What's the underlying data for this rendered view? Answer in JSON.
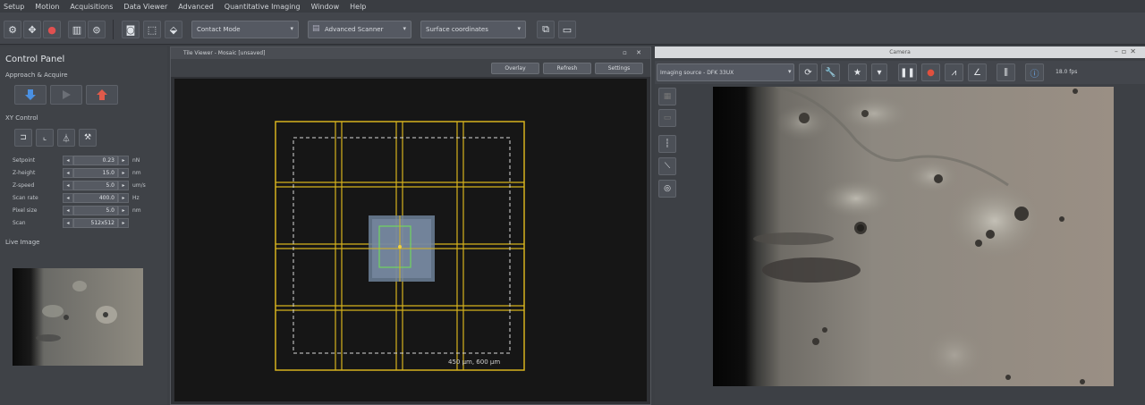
{
  "menu": [
    "Setup",
    "Motion",
    "Acquisitions",
    "Data Viewer",
    "Advanced",
    "Quantitative Imaging",
    "Window",
    "Help"
  ],
  "toolbar": {
    "stage_mode": "Contact Mode",
    "scan_mode": "Advanced Scanner",
    "coord_mode": "Surface coordinates"
  },
  "control_panel": {
    "title": "Control Panel",
    "approach_label": "Approach & Acquire",
    "xy_label": "XY Control",
    "live_label": "Live Image",
    "params": [
      {
        "label": "Setpoint",
        "value": "0.23",
        "unit": "nN"
      },
      {
        "label": "Z-height",
        "value": "15.0",
        "unit": "nm"
      },
      {
        "label": "Z-speed",
        "value": "5.0",
        "unit": "um/s"
      },
      {
        "label": "Scan rate",
        "value": "400.0",
        "unit": "Hz"
      },
      {
        "label": "Pixel size",
        "value": "5.0",
        "unit": "nm"
      },
      {
        "label": "Scan",
        "value": "512x512",
        "unit": ""
      }
    ]
  },
  "tile_viewer": {
    "title": "Tile Viewer - Mosaic [unsaved]",
    "tabs": [
      "Overlay",
      "Refresh",
      "Settings"
    ],
    "scale_text": "450 µm, 600 µm"
  },
  "camera": {
    "title": "Camera",
    "source": "Imaging source - DFK 33UX",
    "fps": "18.0 fps"
  }
}
